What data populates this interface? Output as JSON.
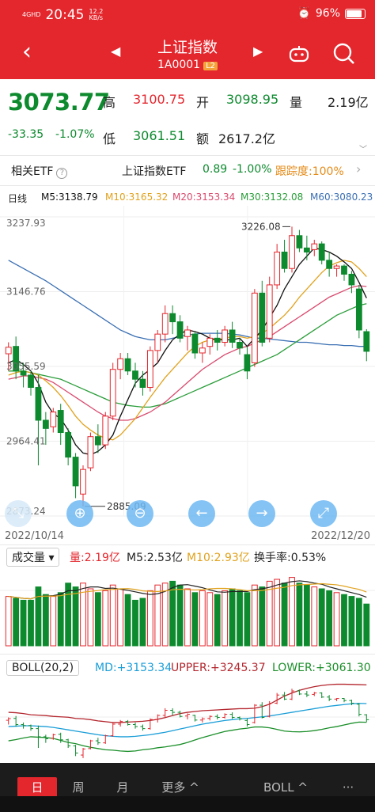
{
  "status_bar": {
    "network": "4GHD",
    "time": "20:45",
    "speed": "12.2",
    "speed_unit": "KB/s",
    "battery": "96%"
  },
  "header": {
    "title": "上证指数",
    "code": "1A0001",
    "badge": "L2"
  },
  "quote": {
    "price": "3073.77",
    "change": "-33.35",
    "change_pct": "-1.07%",
    "high_label": "高",
    "high": "3100.75",
    "open_label": "开",
    "open": "3098.95",
    "volume_label": "量",
    "volume": "2.19亿",
    "low_label": "低",
    "low": "3061.51",
    "amount_label": "额",
    "amount": "2617.2亿"
  },
  "etf": {
    "label": "相关ETF",
    "help": "?",
    "name": "上证指数ETF",
    "value": "0.89",
    "change": "-1.00%",
    "tracking_label": "跟踪度:",
    "tracking": "100%",
    "chevron": "›"
  },
  "ma_legend": {
    "period": "日线",
    "m5": "M5:3138.79",
    "m10": "M10:3165.32",
    "m20": "M20:3153.34",
    "m30": "M30:3132.08",
    "m60": "M60:3080.23"
  },
  "colors": {
    "up": "#e4262d",
    "down": "#0d8a2e",
    "m5": "#111111",
    "m10": "#e1a21d",
    "m20": "#d94a6e",
    "m30": "#2a9d3a",
    "m60": "#3a6fb3",
    "boll_md": "#1a9ed8",
    "boll_upper": "#b3262e",
    "boll_lower": "#1b8f2a"
  },
  "chart_data": [
    {
      "type": "candlestick",
      "y_axis_ticks": [
        "3237.93",
        "3146.76",
        "3055.59",
        "2964.41",
        "2873.24"
      ],
      "ylim": [
        2873.24,
        3237.93
      ],
      "x_range": [
        "2022/10/14",
        "2022/12/20"
      ],
      "annotations": [
        "3226.08",
        "2885.09"
      ],
      "candles": [
        [
          3071,
          3085,
          3050,
          3079
        ],
        [
          3080,
          3092,
          3040,
          3050
        ],
        [
          3050,
          3060,
          3030,
          3045
        ],
        [
          3045,
          3050,
          3020,
          3030
        ],
        [
          3030,
          3045,
          2935,
          2990
        ],
        [
          2990,
          3000,
          2960,
          2980
        ],
        [
          2982,
          3005,
          2975,
          3000
        ],
        [
          3002,
          3010,
          2960,
          2975
        ],
        [
          2975,
          2980,
          2935,
          2945
        ],
        [
          2945,
          2950,
          2895,
          2910
        ],
        [
          2900,
          2935,
          2885,
          2930
        ],
        [
          2932,
          2975,
          2928,
          2970
        ],
        [
          2970,
          2985,
          2950,
          2960
        ],
        [
          2960,
          3000,
          2955,
          2995
        ],
        [
          2995,
          3060,
          2990,
          3052
        ],
        [
          3052,
          3072,
          3040,
          3065
        ],
        [
          3065,
          3072,
          3045,
          3050
        ],
        [
          3050,
          3060,
          3030,
          3040
        ],
        [
          3040,
          3050,
          3020,
          3030
        ],
        [
          3030,
          3080,
          3025,
          3075
        ],
        [
          3075,
          3100,
          3060,
          3095
        ],
        [
          3095,
          3130,
          3085,
          3120
        ],
        [
          3120,
          3130,
          3095,
          3110
        ],
        [
          3110,
          3118,
          3085,
          3090
        ],
        [
          3092,
          3105,
          3075,
          3100
        ],
        [
          3095,
          3098,
          3065,
          3072
        ],
        [
          3072,
          3085,
          3060,
          3078
        ],
        [
          3080,
          3095,
          3070,
          3090
        ],
        [
          3090,
          3100,
          3075,
          3085
        ],
        [
          3085,
          3105,
          3080,
          3100
        ],
        [
          3100,
          3110,
          3078,
          3085
        ],
        [
          3085,
          3090,
          3070,
          3078
        ],
        [
          3070,
          3080,
          3040,
          3050
        ],
        [
          3060,
          3150,
          3055,
          3145
        ],
        [
          3145,
          3160,
          3080,
          3085
        ],
        [
          3090,
          3165,
          3085,
          3155
        ],
        [
          3155,
          3205,
          3150,
          3195
        ],
        [
          3195,
          3210,
          3170,
          3175
        ],
        [
          3175,
          3226,
          3170,
          3215
        ],
        [
          3215,
          3222,
          3195,
          3200
        ],
        [
          3200,
          3215,
          3185,
          3195
        ],
        [
          3198,
          3210,
          3190,
          3205
        ],
        [
          3205,
          3208,
          3180,
          3185
        ],
        [
          3185,
          3195,
          3165,
          3175
        ],
        [
          3175,
          3180,
          3165,
          3178
        ],
        [
          3178,
          3180,
          3160,
          3168
        ],
        [
          3168,
          3172,
          3145,
          3155
        ],
        [
          3150,
          3155,
          3090,
          3100
        ],
        [
          3098,
          3101,
          3062,
          3074
        ]
      ],
      "m5": [
        3060,
        3064,
        3058,
        3050,
        3035,
        3012,
        2998,
        2992,
        2978,
        2960,
        2950,
        2948,
        2952,
        2960,
        2972,
        2995,
        3015,
        3035,
        3045,
        3052,
        3060,
        3075,
        3088,
        3095,
        3100,
        3098,
        3095,
        3090,
        3088,
        3088,
        3088,
        3090,
        3080,
        3090,
        3100,
        3115,
        3130,
        3150,
        3165,
        3180,
        3190,
        3200,
        3198,
        3195,
        3190,
        3183,
        3175,
        3158,
        3139
      ],
      "m10": [
        3045,
        3048,
        3050,
        3048,
        3045,
        3038,
        3030,
        3020,
        3008,
        2995,
        2985,
        2978,
        2972,
        2968,
        2966,
        2972,
        2982,
        2992,
        3005,
        3018,
        3030,
        3042,
        3052,
        3062,
        3072,
        3080,
        3085,
        3088,
        3088,
        3090,
        3092,
        3092,
        3090,
        3092,
        3096,
        3102,
        3110,
        3118,
        3128,
        3140,
        3150,
        3160,
        3170,
        3178,
        3182,
        3185,
        3183,
        3175,
        3165
      ],
      "m20": [
        3040,
        3042,
        3044,
        3044,
        3042,
        3040,
        3036,
        3030,
        3024,
        3018,
        3012,
        3006,
        3000,
        2995,
        2992,
        2990,
        2990,
        2992,
        2996,
        3000,
        3006,
        3012,
        3020,
        3028,
        3036,
        3044,
        3052,
        3058,
        3064,
        3070,
        3074,
        3078,
        3080,
        3084,
        3088,
        3092,
        3098,
        3104,
        3110,
        3116,
        3122,
        3128,
        3134,
        3140,
        3144,
        3148,
        3152,
        3154,
        3153
      ],
      "m30": [
        3050,
        3050,
        3050,
        3048,
        3046,
        3044,
        3042,
        3040,
        3036,
        3032,
        3028,
        3024,
        3020,
        3016,
        3012,
        3010,
        3008,
        3007,
        3006,
        3006,
        3008,
        3010,
        3014,
        3018,
        3022,
        3026,
        3030,
        3034,
        3038,
        3042,
        3046,
        3050,
        3054,
        3058,
        3062,
        3066,
        3070,
        3076,
        3082,
        3088,
        3094,
        3100,
        3106,
        3112,
        3118,
        3122,
        3126,
        3130,
        3132
      ],
      "m60": [
        3185,
        3180,
        3175,
        3170,
        3165,
        3160,
        3154,
        3148,
        3142,
        3136,
        3130,
        3124,
        3118,
        3112,
        3106,
        3100,
        3096,
        3092,
        3090,
        3088,
        3088,
        3088,
        3090,
        3092,
        3094,
        3095,
        3096,
        3096,
        3096,
        3096,
        3095,
        3094,
        3092,
        3090,
        3090,
        3089,
        3088,
        3087,
        3086,
        3085,
        3085,
        3084,
        3083,
        3082,
        3082,
        3081,
        3081,
        3080,
        3080
      ]
    },
    {
      "type": "bar",
      "label": "成交量",
      "volume": "量:2.19亿",
      "m5": "M5:2.53亿",
      "m10": "M10:2.93亿",
      "turnover": "换手率:0.53%",
      "values": [
        2.6,
        2.5,
        2.4,
        2.4,
        3.1,
        2.7,
        2.6,
        2.8,
        3.3,
        3.1,
        3.3,
        3.0,
        2.8,
        2.9,
        3.2,
        3.0,
        2.7,
        2.4,
        2.5,
        2.9,
        3.2,
        3.3,
        3.4,
        3.2,
        3.0,
        2.8,
        2.9,
        2.8,
        2.7,
        2.9,
        3.0,
        2.9,
        2.8,
        3.2,
        3.1,
        3.4,
        3.5,
        3.3,
        3.6,
        3.3,
        3.2,
        3.1,
        3.0,
        2.9,
        2.8,
        2.7,
        2.6,
        2.5,
        2.2
      ],
      "ylim": [
        0,
        4
      ]
    },
    {
      "type": "line",
      "label": "BOLL(20,2)",
      "md": "MD:+3153.34",
      "upper": "UPPER:+3245.37",
      "lower": "LOWER:+3061.30",
      "upper_values": [
        3110,
        3108,
        3104,
        3098,
        3096,
        3094,
        3090,
        3088,
        3086,
        3080,
        3078,
        3074,
        3068,
        3064,
        3060,
        3060,
        3062,
        3064,
        3066,
        3070,
        3076,
        3084,
        3094,
        3104,
        3110,
        3114,
        3118,
        3120,
        3122,
        3124,
        3126,
        3128,
        3128,
        3130,
        3138,
        3150,
        3170,
        3190,
        3205,
        3218,
        3228,
        3236,
        3242,
        3246,
        3248,
        3248,
        3247,
        3246,
        3245
      ],
      "md_values": [
        3040,
        3042,
        3044,
        3044,
        3042,
        3040,
        3036,
        3030,
        3024,
        3018,
        3012,
        3006,
        3000,
        2995,
        2992,
        2990,
        2990,
        2992,
        2996,
        3000,
        3006,
        3012,
        3020,
        3028,
        3036,
        3044,
        3052,
        3058,
        3064,
        3070,
        3074,
        3078,
        3080,
        3084,
        3088,
        3092,
        3098,
        3104,
        3110,
        3116,
        3122,
        3128,
        3134,
        3140,
        3144,
        3148,
        3152,
        3154,
        3153
      ],
      "lower_values": [
        2970,
        2976,
        2984,
        2990,
        2988,
        2986,
        2982,
        2972,
        2962,
        2956,
        2946,
        2938,
        2932,
        2926,
        2924,
        2920,
        2918,
        2920,
        2926,
        2930,
        2936,
        2940,
        2946,
        2952,
        2962,
        2974,
        2986,
        2996,
        3006,
        3016,
        3022,
        3028,
        3032,
        3038,
        3038,
        3034,
        3026,
        3018,
        3015,
        3014,
        3016,
        3020,
        3026,
        3034,
        3040,
        3048,
        3056,
        3062,
        3061
      ]
    }
  ],
  "tabs": {
    "day": "日",
    "week": "周",
    "month": "月",
    "more": "更多 ^",
    "indicator": "BOLL ^",
    "options": "···"
  }
}
